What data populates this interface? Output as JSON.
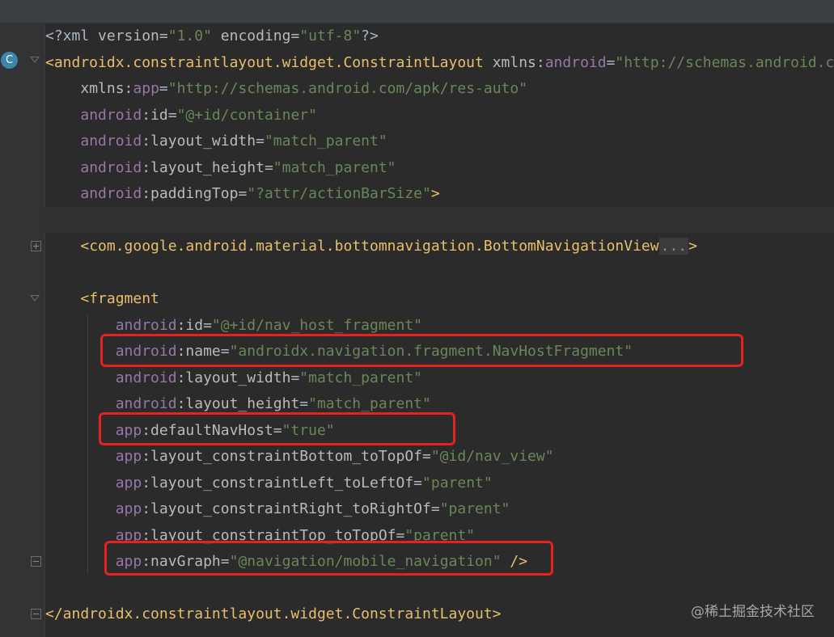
{
  "gutter": {
    "class_badge": "C"
  },
  "lines": [
    {
      "tokens": [
        {
          "c": "t-plain",
          "t": "<?xml "
        },
        {
          "c": "t-attr",
          "t": "version"
        },
        {
          "c": "t-plain",
          "t": "="
        },
        {
          "c": "t-str",
          "t": "\"1.0\""
        },
        {
          "c": "t-plain",
          "t": " "
        },
        {
          "c": "t-attr",
          "t": "encoding"
        },
        {
          "c": "t-plain",
          "t": "="
        },
        {
          "c": "t-str",
          "t": "\"utf-8\""
        },
        {
          "c": "t-plain",
          "t": "?>"
        }
      ]
    },
    {
      "tokens": [
        {
          "c": "t-tag",
          "t": "<androidx.constraintlayout.widget.ConstraintLayout "
        },
        {
          "c": "t-attr",
          "t": "xmlns:"
        },
        {
          "c": "t-ns",
          "t": "android"
        },
        {
          "c": "t-plain",
          "t": "="
        },
        {
          "c": "t-str",
          "t": "\"http://schemas.android.com/apk/res/android\""
        }
      ]
    },
    {
      "tokens": [
        {
          "c": "t-plain",
          "t": "    "
        },
        {
          "c": "t-attr",
          "t": "xmlns:"
        },
        {
          "c": "t-ns",
          "t": "app"
        },
        {
          "c": "t-plain",
          "t": "="
        },
        {
          "c": "t-str",
          "t": "\"http://schemas.android.com/apk/res-auto\""
        }
      ]
    },
    {
      "tokens": [
        {
          "c": "t-plain",
          "t": "    "
        },
        {
          "c": "t-ns",
          "t": "android"
        },
        {
          "c": "t-attr",
          "t": ":id"
        },
        {
          "c": "t-plain",
          "t": "="
        },
        {
          "c": "t-str",
          "t": "\"@+id/container\""
        }
      ]
    },
    {
      "tokens": [
        {
          "c": "t-plain",
          "t": "    "
        },
        {
          "c": "t-ns",
          "t": "android"
        },
        {
          "c": "t-attr",
          "t": ":layout_width"
        },
        {
          "c": "t-plain",
          "t": "="
        },
        {
          "c": "t-str",
          "t": "\"match_parent\""
        }
      ]
    },
    {
      "tokens": [
        {
          "c": "t-plain",
          "t": "    "
        },
        {
          "c": "t-ns",
          "t": "android"
        },
        {
          "c": "t-attr",
          "t": ":layout_height"
        },
        {
          "c": "t-plain",
          "t": "="
        },
        {
          "c": "t-str",
          "t": "\"match_parent\""
        }
      ]
    },
    {
      "tokens": [
        {
          "c": "t-plain",
          "t": "    "
        },
        {
          "c": "t-ns",
          "t": "android"
        },
        {
          "c": "t-attr",
          "t": ":paddingTop"
        },
        {
          "c": "t-plain",
          "t": "="
        },
        {
          "c": "t-str",
          "t": "\"?attr/actionBarSize\""
        },
        {
          "c": "t-tag",
          "t": ">"
        }
      ]
    },
    {
      "tokens": [
        {
          "c": "t-plain",
          "t": ""
        }
      ]
    },
    {
      "tokens": [
        {
          "c": "t-plain",
          "t": "    "
        },
        {
          "c": "t-tag",
          "t": "<com.google.android.material.bottomnavigation.BottomNavigationView"
        },
        {
          "c": "t-fold",
          "t": "..."
        },
        {
          "c": "t-tag",
          "t": ">"
        }
      ]
    },
    {
      "tokens": [
        {
          "c": "t-plain",
          "t": ""
        }
      ]
    },
    {
      "tokens": [
        {
          "c": "t-plain",
          "t": "    "
        },
        {
          "c": "t-tag",
          "t": "<fragment"
        }
      ]
    },
    {
      "tokens": [
        {
          "c": "t-plain",
          "t": "        "
        },
        {
          "c": "t-ns",
          "t": "android"
        },
        {
          "c": "t-attr",
          "t": ":id"
        },
        {
          "c": "t-plain",
          "t": "="
        },
        {
          "c": "t-str",
          "t": "\"@+id/nav_host_fragment\""
        }
      ]
    },
    {
      "tokens": [
        {
          "c": "t-plain",
          "t": "        "
        },
        {
          "c": "t-ns",
          "t": "android"
        },
        {
          "c": "t-attr",
          "t": ":name"
        },
        {
          "c": "t-plain",
          "t": "="
        },
        {
          "c": "t-str",
          "t": "\"androidx.navigation.fragment.NavHostFragment\""
        }
      ]
    },
    {
      "tokens": [
        {
          "c": "t-plain",
          "t": "        "
        },
        {
          "c": "t-ns",
          "t": "android"
        },
        {
          "c": "t-attr",
          "t": ":layout_width"
        },
        {
          "c": "t-plain",
          "t": "="
        },
        {
          "c": "t-str",
          "t": "\"match_parent\""
        }
      ]
    },
    {
      "tokens": [
        {
          "c": "t-plain",
          "t": "        "
        },
        {
          "c": "t-ns",
          "t": "android"
        },
        {
          "c": "t-attr",
          "t": ":layout_height"
        },
        {
          "c": "t-plain",
          "t": "="
        },
        {
          "c": "t-str",
          "t": "\"match_parent\""
        }
      ]
    },
    {
      "tokens": [
        {
          "c": "t-plain",
          "t": "        "
        },
        {
          "c": "t-ns",
          "t": "app"
        },
        {
          "c": "t-attr",
          "t": ":defaultNavHost"
        },
        {
          "c": "t-plain",
          "t": "="
        },
        {
          "c": "t-str",
          "t": "\"true\""
        }
      ]
    },
    {
      "tokens": [
        {
          "c": "t-plain",
          "t": "        "
        },
        {
          "c": "t-ns",
          "t": "app"
        },
        {
          "c": "t-attr",
          "t": ":layout_constraintBottom_toTopOf"
        },
        {
          "c": "t-plain",
          "t": "="
        },
        {
          "c": "t-str",
          "t": "\"@id/nav_view\""
        }
      ]
    },
    {
      "tokens": [
        {
          "c": "t-plain",
          "t": "        "
        },
        {
          "c": "t-ns",
          "t": "app"
        },
        {
          "c": "t-attr",
          "t": ":layout_constraintLeft_toLeftOf"
        },
        {
          "c": "t-plain",
          "t": "="
        },
        {
          "c": "t-str",
          "t": "\"parent\""
        }
      ]
    },
    {
      "tokens": [
        {
          "c": "t-plain",
          "t": "        "
        },
        {
          "c": "t-ns",
          "t": "app"
        },
        {
          "c": "t-attr",
          "t": ":layout_constraintRight_toRightOf"
        },
        {
          "c": "t-plain",
          "t": "="
        },
        {
          "c": "t-str",
          "t": "\"parent\""
        }
      ]
    },
    {
      "tokens": [
        {
          "c": "t-plain",
          "t": "        "
        },
        {
          "c": "t-ns",
          "t": "app"
        },
        {
          "c": "t-attr",
          "t": ":layout_constraintTop_toTopOf"
        },
        {
          "c": "t-plain",
          "t": "="
        },
        {
          "c": "t-str",
          "t": "\"parent\""
        }
      ]
    },
    {
      "tokens": [
        {
          "c": "t-plain",
          "t": "        "
        },
        {
          "c": "t-ns",
          "t": "app"
        },
        {
          "c": "t-attr",
          "t": ":navGraph"
        },
        {
          "c": "t-plain",
          "t": "="
        },
        {
          "c": "t-str",
          "t": "\"@navigation/mobile_navigation\""
        },
        {
          "c": "t-plain",
          "t": " "
        },
        {
          "c": "t-tag",
          "t": "/>"
        }
      ]
    },
    {
      "tokens": [
        {
          "c": "t-plain",
          "t": ""
        }
      ]
    },
    {
      "tokens": [
        {
          "c": "t-tag",
          "t": "</androidx.constraintlayout.widget.ConstraintLayout>"
        }
      ]
    }
  ],
  "watermark": "@稀土掘金技术社区",
  "colors": {
    "background": "#2b2b2b",
    "gutter": "#313335",
    "tag": "#e8bf6a",
    "namespace": "#9876aa",
    "string": "#6a8759",
    "highlight_box": "#e8201f"
  }
}
